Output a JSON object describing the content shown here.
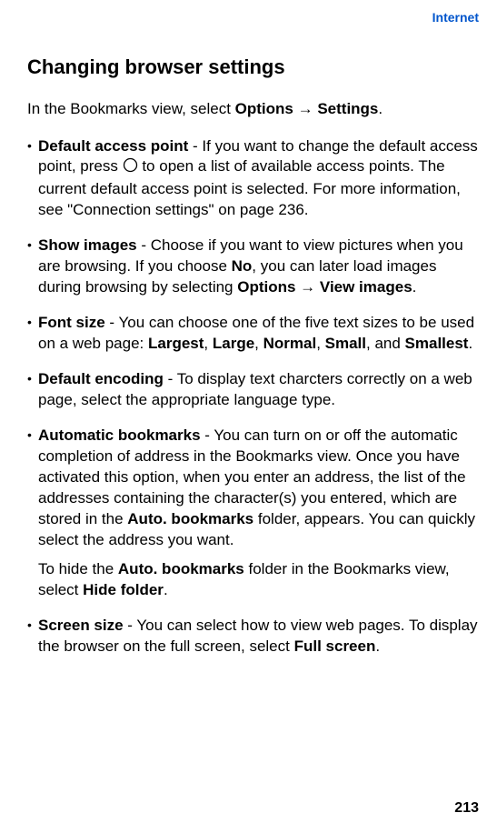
{
  "header": {
    "section": "Internet"
  },
  "title": "Changing browser settings",
  "intro": {
    "prefix": "In the Bookmarks view, select ",
    "b1": "Options",
    "arrow": " → ",
    "b2": "Settings",
    "suffix": "."
  },
  "items": {
    "dap": {
      "label": "Default access point",
      "t1": " - If you want to change the default access point, press ",
      "t2": " to open a list of available access points. The current default access point is selected. For more information, see \"Connection settings\" on page 236."
    },
    "si": {
      "label": "Show images",
      "t1": " - Choose if you want to view pictures when you are browsing. If you choose ",
      "b1": "No",
      "t2": ", you can later load images during browsing by selecting ",
      "b2": "Options",
      "arrow": " → ",
      "b3": "View images",
      "t3": "."
    },
    "fs": {
      "label": "Font size",
      "t1": " - You can choose one of the five text sizes to be used on a web page: ",
      "b1": "Largest",
      "c1": ", ",
      "b2": "Large",
      "c2": ", ",
      "b3": "Normal",
      "c3": ", ",
      "b4": "Small",
      "c4": ", and ",
      "b5": "Smallest",
      "c5": "."
    },
    "de": {
      "label": "Default encoding",
      "t1": " - To display text charcters correctly on a web page, select the appropriate language type."
    },
    "ab": {
      "label": "Automatic bookmarks",
      "t1": " - You can turn on or off the automatic completion of address in the Bookmarks view. Once you have activated this option, when you enter an address, the list of the addresses containing the character(s) you entered, which are stored in the ",
      "b1": "Auto. bookmarks",
      "t2": " folder, appears. You can quickly select the address you want."
    },
    "ab2": {
      "t1": "To hide the ",
      "b1": "Auto. bookmarks",
      "t2": " folder in the Bookmarks view, select ",
      "b2": "Hide folder",
      "t3": "."
    },
    "ss": {
      "label": "Screen size",
      "t1": " - You can select how to view web pages. To display the browser on the full screen, select ",
      "b1": "Full screen",
      "t2": "."
    }
  },
  "pageNumber": "213"
}
